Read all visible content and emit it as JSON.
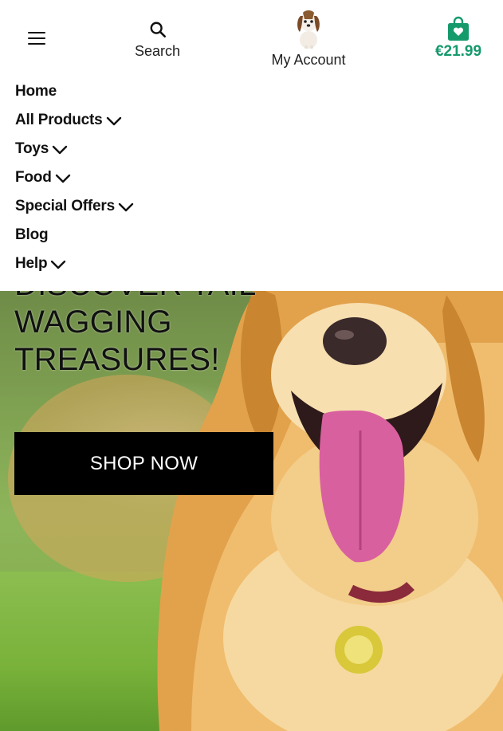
{
  "header": {
    "menu_icon": "hamburger-menu-icon",
    "search_label": "Search",
    "search_icon": "search-icon",
    "account_label": "My Account",
    "account_icon": "puppy-avatar-icon",
    "cart_total": "€21.99",
    "cart_icon": "shopping-bag-heart-icon",
    "accent_color": "#159a6b"
  },
  "nav": {
    "items": [
      {
        "label": "Home",
        "has_dropdown": false
      },
      {
        "label": "All Products",
        "has_dropdown": true
      },
      {
        "label": "Toys",
        "has_dropdown": true
      },
      {
        "label": "Food",
        "has_dropdown": true
      },
      {
        "label": "Special Offers",
        "has_dropdown": true
      },
      {
        "label": "Blog",
        "has_dropdown": false
      },
      {
        "label": "Help",
        "has_dropdown": true
      }
    ]
  },
  "hero": {
    "title_lines": [
      "DISCOVER TAIL-",
      "WAGGING",
      "TREASURES!"
    ],
    "cta_label": "SHOP NOW",
    "image": "golden-retriever-on-grass"
  }
}
